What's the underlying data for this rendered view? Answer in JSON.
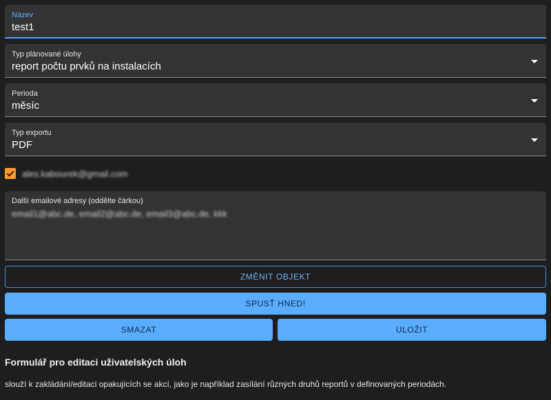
{
  "form": {
    "name": {
      "label": "Název",
      "value": "test1"
    },
    "task_type": {
      "label": "Typ plánované úlohy",
      "value": "report počtu prvků na instalacích"
    },
    "period": {
      "label": "Perioda",
      "value": "měsíc"
    },
    "export_type": {
      "label": "Typ exportu",
      "value": "PDF"
    },
    "email_checkbox": {
      "label": "ales.kabourek@gmail.com",
      "checked": true
    },
    "extra_emails": {
      "label": "Další emailové adresy (oddělte čárkou)",
      "value": "email1@abc.de, email2@abc.de, email3@abc.de, kkk"
    }
  },
  "buttons": {
    "change_object": "ZMĚNIT OBJEKT",
    "run_now": "SPUSŤ HNED!",
    "delete": "SMAZAT",
    "save": "ULOŽIT"
  },
  "info": {
    "title": "Formulář pro editaci uživatelských úloh",
    "description": "slouží k zakládání/editaci opakujících se akcí, jako je například zasílání různých druhů reportů v definovaných periodách."
  },
  "colors": {
    "accent": "#5aacff",
    "checkbox": "#ff9a2e",
    "background": "#1e1e1e",
    "field_bg": "#333333"
  }
}
